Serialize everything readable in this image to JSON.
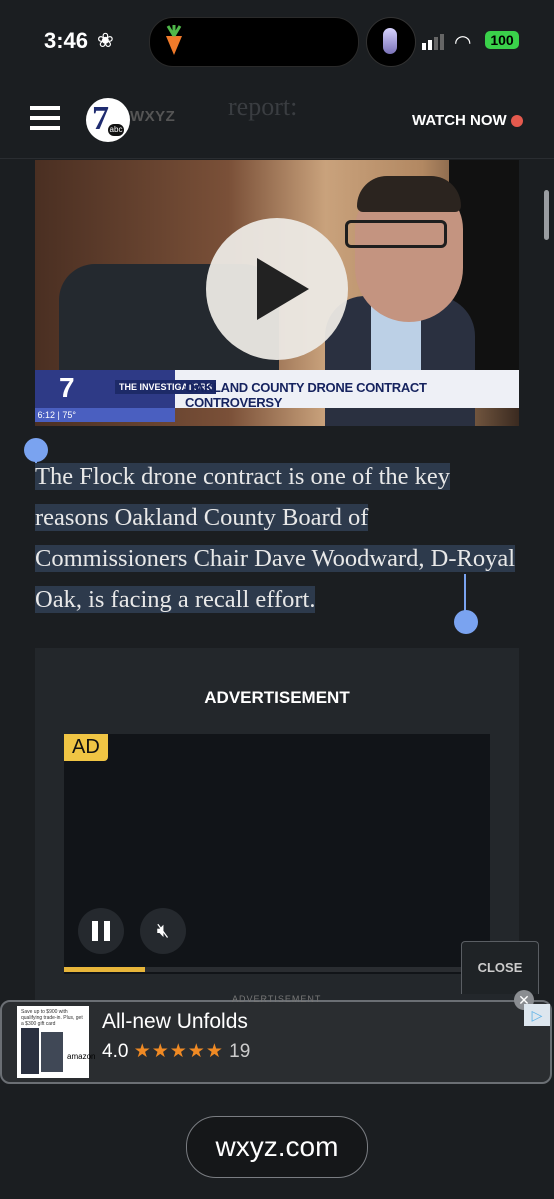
{
  "status_bar": {
    "time": "3:46",
    "battery": "100"
  },
  "nav": {
    "logo_number": "7",
    "logo_abc": "abc",
    "logo_text": "WXYZ",
    "ghost_title": "report:",
    "watch_now": "WATCH NOW"
  },
  "video": {
    "channel_logo": "7",
    "segment": "THE INVESTIGATORS",
    "headline": "OAKLAND COUNTY DRONE CONTRACT CONTROVERSY",
    "ticker": "6:12 | 75°"
  },
  "article": {
    "paragraph": "The Flock drone contract is one of the key reasons Oakland County Board of Commissioners Chair Dave Woodward, D-Royal Oak, is facing a recall effort."
  },
  "ad": {
    "label": "ADVERTISEMENT",
    "tag": "AD",
    "close": "CLOSE",
    "progress_fraction": 0.19
  },
  "banner": {
    "ghost_label": "ADVERTISEMENT",
    "product": "All-new Unfolds",
    "rating": "4.0",
    "stars": "★★★★★",
    "count": "19",
    "small_print": "Save up to $900 with qualifying trade-in. Plus, get a $300 gift card",
    "store_mark": "amazon",
    "adchoices": "▷"
  },
  "browser": {
    "url": "wxyz.com"
  },
  "colors": {
    "accent_red": "#e55a4e",
    "progress": "#e7b53a",
    "selection": "#2d3a4c",
    "handle": "#7aa3f0"
  }
}
